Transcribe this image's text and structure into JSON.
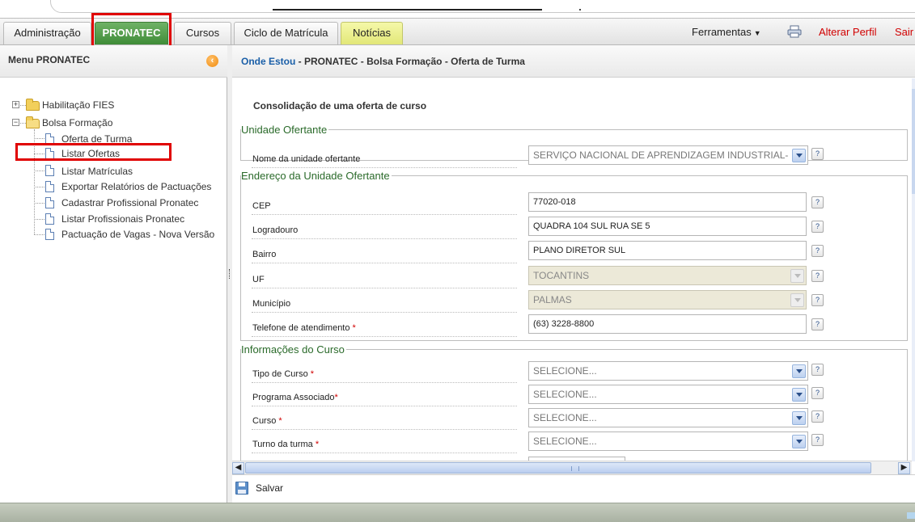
{
  "tabs": [
    {
      "label": "Administração"
    },
    {
      "label": "PRONATEC",
      "active": true
    },
    {
      "label": "Cursos"
    },
    {
      "label": "Ciclo de Matrícula"
    },
    {
      "label": "Notícias"
    }
  ],
  "toolbar": {
    "tools_label": "Ferramentas",
    "change_profile_label": "Alterar Perfil",
    "exit_label": "Sair"
  },
  "left_menu": {
    "title": "Menu PRONATEC",
    "tree": [
      {
        "label": "Habilitação FIES",
        "type": "folder",
        "expanded": false
      },
      {
        "label": "Bolsa Formação",
        "type": "folder",
        "expanded": true
      },
      {
        "label": "Oferta de Turma"
      },
      {
        "label": "Listar Ofertas"
      },
      {
        "label": "Listar Matrículas"
      },
      {
        "label": "Exportar Relatórios de Pactuações"
      },
      {
        "label": "Cadastrar Profissional Pronatec"
      },
      {
        "label": "Listar Profissionais Pronatec"
      },
      {
        "label": "Pactuação de Vagas - Nova Versão"
      }
    ]
  },
  "breadcrumb": {
    "label": "Onde Estou",
    "path": " - PRONATEC - Bolsa Formação - Oferta de Turma"
  },
  "form": {
    "title": "Consolidação de uma oferta de curso",
    "sections": [
      {
        "legend": "Unidade Ofertante",
        "fields": [
          {
            "label": "Nome da unidade ofertante",
            "value": "SERVIÇO NACIONAL DE APRENDIZAGEM INDUSTRIAL-",
            "type": "select"
          }
        ]
      },
      {
        "legend": "Endereço da Unidade Ofertante",
        "fields": [
          {
            "label": "CEP",
            "value": "77020-018",
            "type": "text"
          },
          {
            "label": "Logradouro",
            "value": "QUADRA 104 SUL RUA SE 5",
            "type": "text"
          },
          {
            "label": "Bairro",
            "value": "PLANO DIRETOR SUL",
            "type": "text"
          },
          {
            "label": "UF",
            "value": "TOCANTINS",
            "type": "select-disabled"
          },
          {
            "label": "Município",
            "value": "PALMAS",
            "type": "select-disabled"
          },
          {
            "label": "Telefone de atendimento",
            "required_mark": "*",
            "value": "(63) 3228-8800",
            "type": "text"
          }
        ]
      },
      {
        "legend": "Informações do Curso",
        "fields": [
          {
            "label": "Tipo de Curso",
            "required_mark": "*",
            "value": "SELECIONE...",
            "type": "select"
          },
          {
            "label": "Programa Associado",
            "required_mark": "*",
            "value": "SELECIONE...",
            "type": "select"
          },
          {
            "label": "Curso",
            "required_mark": "*",
            "value": "SELECIONE...",
            "type": "select"
          },
          {
            "label": "Turno da turma",
            "required_mark": "*",
            "value": "SELECIONE...",
            "type": "select"
          }
        ]
      }
    ],
    "help_glyph": "?"
  },
  "actions": {
    "save_label": "Salvar"
  },
  "icons": {
    "print": "printer-icon",
    "collapse": "collapse-left-icon",
    "save": "floppy-disk-icon",
    "folder": "folder-icon",
    "document": "document-icon"
  },
  "colors": {
    "active_tab": "#4f9a45",
    "news_tab": "#eef38f",
    "link_red": "#d10000",
    "breadcrumb_blue": "#1a5fa8",
    "legend_green": "#2a6a2a",
    "highlight_red": "#e00000",
    "status_bar": "#b3baad"
  }
}
